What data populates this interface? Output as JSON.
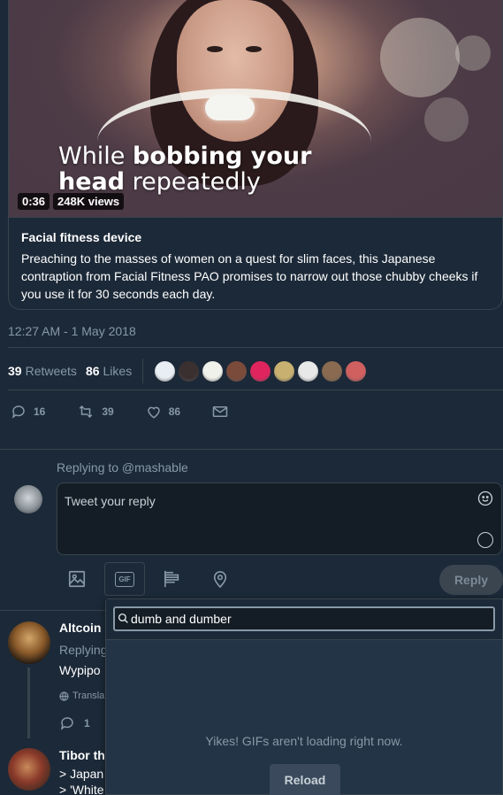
{
  "video": {
    "caption_line1_normal": "While ",
    "caption_line1_bold": "bobbing your",
    "caption_line2_bold": "head",
    "caption_line2_normal": " repeatedly",
    "duration": "0:36",
    "views": "248K views"
  },
  "card": {
    "title": "Facial fitness device",
    "description": "Preaching to the masses of women on a quest for slim faces, this Japanese contraption from Facial Fitness PAO promises to narrow out those chubby cheeks if you use it for 30 seconds each day."
  },
  "tweet": {
    "timestamp": "12:27 AM - 1 May 2018",
    "retweets_count": "39",
    "retweets_label": "Retweets",
    "likes_count": "86",
    "likes_label": "Likes",
    "liker_avatar_colors": [
      "#e8eef3",
      "#3a3030",
      "#f1f1ec",
      "#7a4a3a",
      "#e0245e",
      "#c8b070",
      "#e8e8e8",
      "#8a6a50",
      "#d06060"
    ]
  },
  "actions": {
    "replies": "16",
    "retweets": "39",
    "likes": "86"
  },
  "composer": {
    "replying_to": "Replying to @mashable",
    "placeholder": "Tweet your reply",
    "reply_button": "Reply",
    "gif_label": "GIF"
  },
  "replies": [
    {
      "name": "Altcoin",
      "sub": "Replying",
      "text": "Wypipo",
      "translate": "Transla",
      "reply_count": "1"
    },
    {
      "name": "Tibor th",
      "line1": "> Japan",
      "line2": "> 'White"
    }
  ],
  "gif_picker": {
    "search_value": "dumb and dumber",
    "error_message": "Yikes! GIFs aren't loading right now.",
    "reload_label": "Reload"
  },
  "colors": {
    "background": "#1c2938",
    "border": "#38444d",
    "muted": "#8899a6"
  }
}
